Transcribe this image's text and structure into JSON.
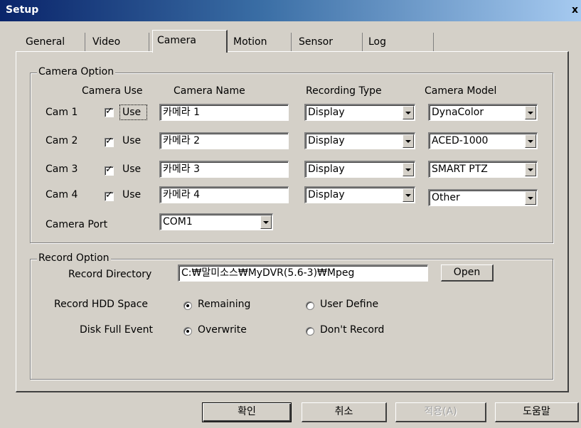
{
  "window": {
    "title": "Setup",
    "close_glyph": "x"
  },
  "tabs": [
    {
      "label": "General"
    },
    {
      "label": "Video"
    },
    {
      "label": "Camera"
    },
    {
      "label": "Motion"
    },
    {
      "label": "Sensor"
    },
    {
      "label": "Log"
    }
  ],
  "camera_option": {
    "label": "Camera Option",
    "headers": {
      "use": "Camera Use",
      "name": "Camera Name",
      "recording": "Recording Type",
      "model": "Camera Model"
    },
    "rows": [
      {
        "cam": "Cam 1",
        "use_label": "Use",
        "checked": true,
        "name": "카메라 1",
        "recording": "Display",
        "model": "DynaColor"
      },
      {
        "cam": "Cam 2",
        "use_label": "Use",
        "checked": true,
        "name": "카메라 2",
        "recording": "Display",
        "model": "ACED-1000"
      },
      {
        "cam": "Cam 3",
        "use_label": "Use",
        "checked": true,
        "name": "카메라 3",
        "recording": "Display",
        "model": "SMART PTZ"
      },
      {
        "cam": "Cam 4",
        "use_label": "Use",
        "checked": true,
        "name": "카메라 4",
        "recording": "Display",
        "model": "Other"
      }
    ],
    "port_label": "Camera Port",
    "port_value": "COM1"
  },
  "record_option": {
    "label": "Record Option",
    "directory_label": "Record Directory",
    "directory_value": "C:₩말미소스₩MyDVR(5.6-3)₩Mpeg",
    "open_label": "Open",
    "hdd_label": "Record HDD Space",
    "hdd_options": [
      "Remaining",
      "User Define"
    ],
    "hdd_selected": 0,
    "diskfull_label": "Disk Full Event",
    "diskfull_options": [
      "Overwrite",
      "Don't Record"
    ],
    "diskfull_selected": 0
  },
  "buttons": {
    "ok": "확인",
    "cancel": "취소",
    "apply": "적용(A)",
    "help": "도움말"
  }
}
